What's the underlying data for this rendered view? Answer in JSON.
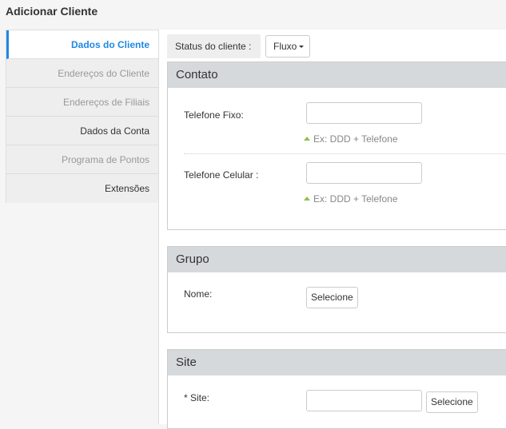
{
  "page": {
    "title": "Adicionar Cliente"
  },
  "tabs": [
    {
      "label": "Dados do Cliente",
      "state": "active"
    },
    {
      "label": "Endereços do Cliente",
      "state": "disabled"
    },
    {
      "label": "Endereços de Filiais",
      "state": "disabled"
    },
    {
      "label": "Dados da Conta",
      "state": "enabled"
    },
    {
      "label": "Programa de Pontos",
      "state": "disabled"
    },
    {
      "label": "Extensões",
      "state": "enabled"
    }
  ],
  "status": {
    "label": "Status do cliente :",
    "value": "Fluxo"
  },
  "contato": {
    "title": "Contato",
    "telefone_fixo": {
      "label": "Telefone Fixo:",
      "value": "",
      "hint": "Ex: DDD + Telefone"
    },
    "telefone_celular": {
      "label": "Telefone Celular :",
      "value": "",
      "hint": "Ex: DDD + Telefone"
    }
  },
  "grupo": {
    "title": "Grupo",
    "nome_label": "Nome:",
    "select_button": "Selecione"
  },
  "site": {
    "title": "Site",
    "site_label": "* Site:",
    "value": "",
    "select_button": "Selecione"
  },
  "colors": {
    "accent": "#1e88e5",
    "panel_header": "#d6d9dc",
    "hint_arrow": "#8bc34a"
  }
}
